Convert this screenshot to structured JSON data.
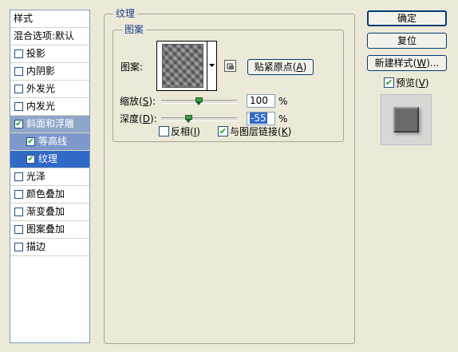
{
  "style_list": {
    "header": "样式",
    "blending_options": "混合选项:默认",
    "items": [
      {
        "label": "投影",
        "checked": false
      },
      {
        "label": "内阴影",
        "checked": false
      },
      {
        "label": "外发光",
        "checked": false
      },
      {
        "label": "内发光",
        "checked": false
      },
      {
        "label": "斜面和浮雕",
        "checked": true
      },
      {
        "label": "等高线",
        "checked": true
      },
      {
        "label": "纹理",
        "checked": true
      },
      {
        "label": "光泽",
        "checked": false
      },
      {
        "label": "颜色叠加",
        "checked": false
      },
      {
        "label": "渐变叠加",
        "checked": false
      },
      {
        "label": "图案叠加",
        "checked": false
      },
      {
        "label": "描边",
        "checked": false
      }
    ],
    "checkmark": "✔"
  },
  "texture_panel": {
    "group_title": "纹理",
    "pattern_group_title": "图案",
    "pattern_label": "图案:",
    "snap_button": {
      "text": "贴紧原点(",
      "mnemonic": "A",
      "close": ")"
    },
    "scale": {
      "label": "缩放(",
      "mnemonic": "S",
      "close": "):",
      "value": "100",
      "unit": "%",
      "slider_level": 0.5
    },
    "depth": {
      "label": "深度(",
      "mnemonic": "D",
      "close": "):",
      "value": "-55",
      "unit": "%",
      "slider_level": 0.36
    },
    "invert": {
      "label": "反相(",
      "mnemonic": "I",
      "close": ")",
      "checked": false
    },
    "link_with_layer": {
      "label": "与图层链接(",
      "mnemonic": "K",
      "close": ")",
      "checked": true
    }
  },
  "buttons": {
    "ok": "确定",
    "reset": "复位",
    "new_style": {
      "text": "新建样式(",
      "mnemonic": "W",
      "close": ")..."
    }
  },
  "preview": {
    "label": "预览(",
    "mnemonic": "V",
    "close": ")",
    "checked": true
  },
  "colors": {
    "selected": "#3169c6",
    "highlight": "#8fa5c9",
    "accent_green": "#21a121"
  }
}
